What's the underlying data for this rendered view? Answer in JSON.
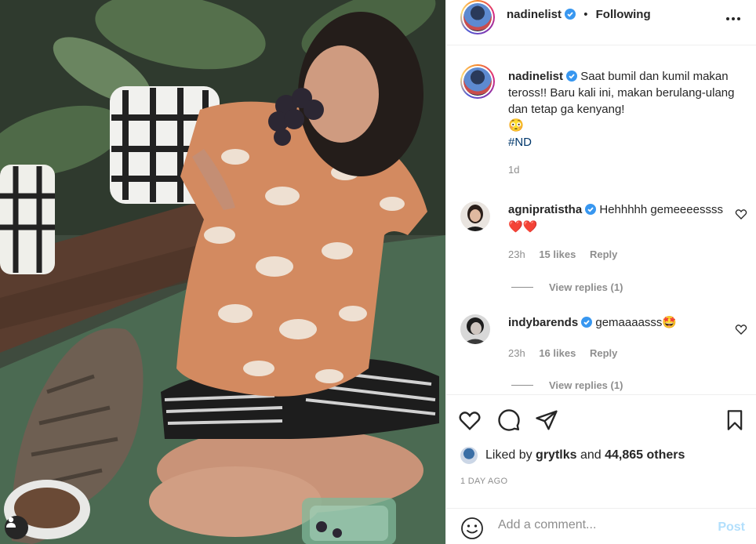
{
  "post": {
    "photo_alt": "",
    "user_tag_icon": "person-icon"
  },
  "header": {
    "username": "nadinelist",
    "dot": "•",
    "follow_status": "Following",
    "more_icon": "more-horizontal-icon"
  },
  "caption": {
    "username": "nadinelist",
    "text": "Saat bumil dan kumil makan teross!! Baru kali ini, makan berulang-ulang dan tetap ga kenyang!",
    "emoji": "😳",
    "hashtag": "#ND",
    "time": "1d"
  },
  "comments": [
    {
      "username": "agnipratistha",
      "text": "Hehhhhh gemeeeessss",
      "emoji": "❤️❤️",
      "time": "23h",
      "likes": "15 likes",
      "reply": "Reply",
      "view_replies": "View replies (1)"
    },
    {
      "username": "indybarends",
      "text": "gemaaaasss",
      "emoji": "🤩",
      "time": "23h",
      "likes": "16 likes",
      "reply": "Reply",
      "view_replies": "View replies (1)"
    }
  ],
  "actions": {
    "like_icon": "heart-icon",
    "comment_icon": "comment-icon",
    "share_icon": "paper-plane-icon",
    "save_icon": "bookmark-icon"
  },
  "likes": {
    "prefix": "Liked by",
    "user": "grytlks",
    "and": "and",
    "others": "44,865 others"
  },
  "date": "1 DAY AGO",
  "comment_box": {
    "placeholder": "Add a comment...",
    "post_label": "Post"
  },
  "colors": {
    "verified": "#3897f0",
    "hashtag": "#00376b",
    "post_disabled": "#b2dffc",
    "muted": "#8e8e8e"
  }
}
